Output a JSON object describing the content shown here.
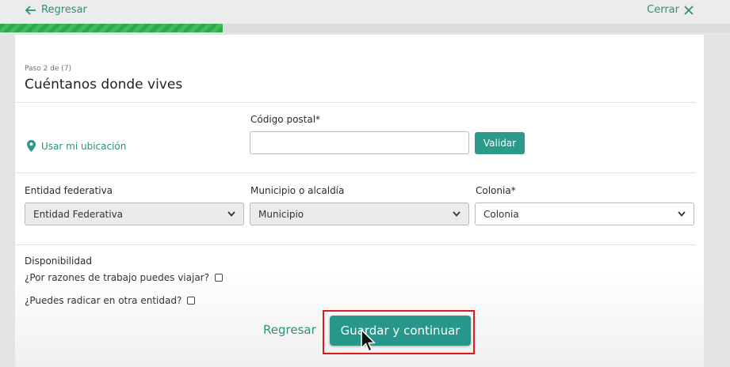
{
  "header": {
    "back_label": "Regresar",
    "close_label": "Cerrar",
    "progress_fraction": 0.305
  },
  "form": {
    "step": "Paso 2 de (7)",
    "title": "Cuéntanos donde vives",
    "use_location_label": "Usar mi ubicación",
    "postal_code": {
      "label": "Código postal*",
      "value": ""
    },
    "validate_label": "Validar",
    "state": {
      "label": "Entidad federativa",
      "selected": "Entidad Federativa"
    },
    "municipality": {
      "label": "Municipio o alcaldía",
      "selected": "Municipio"
    },
    "neighborhood": {
      "label": "Colonia*",
      "selected": "Colonia"
    },
    "availability": {
      "title": "Disponibilidad",
      "travel_question": "¿Por razones de trabajo puedes viajar?",
      "relocate_question": "¿Puedes radicar en otra entidad?"
    }
  },
  "actions": {
    "back_label": "Regresar",
    "save_label": "Guardar y continuar"
  },
  "colors": {
    "accent": "#2a9a8a",
    "progress": "#2ea84c",
    "highlight": "#e01a1a"
  }
}
